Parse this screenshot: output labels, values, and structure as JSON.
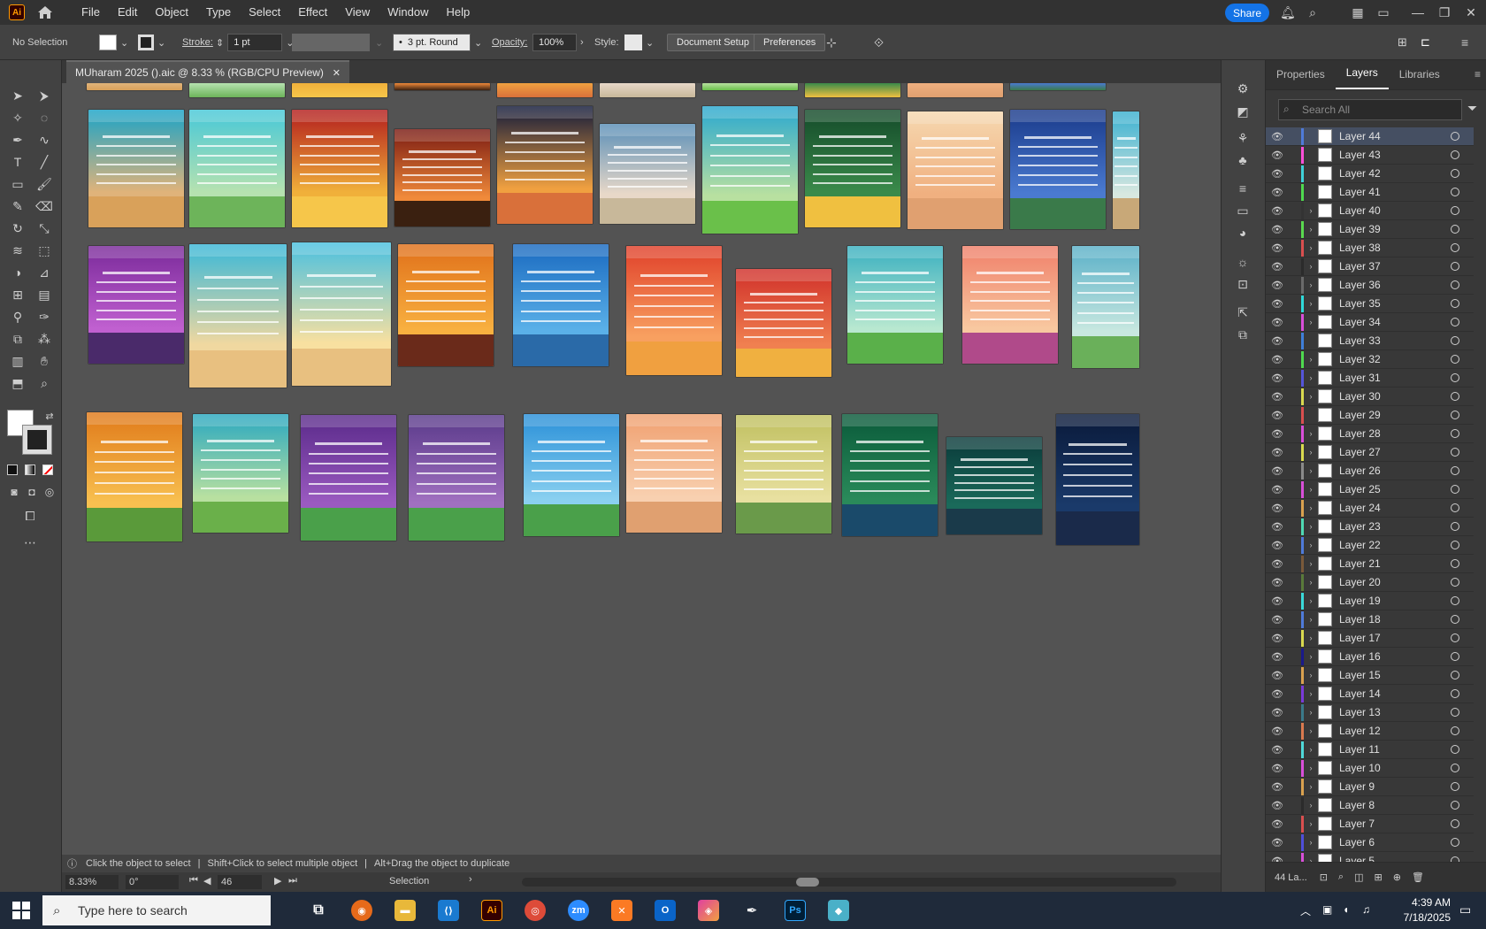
{
  "app": {
    "logo": "Ai"
  },
  "menu": [
    "File",
    "Edit",
    "Object",
    "Type",
    "Select",
    "Effect",
    "View",
    "Window",
    "Help"
  ],
  "share_label": "Share",
  "control": {
    "selection": "No Selection",
    "stroke_label": "Stroke:",
    "stroke_value": "1 pt",
    "brush": "3 pt. Round",
    "opacity_label": "Opacity:",
    "opacity_value": "100%",
    "style_label": "Style:",
    "doc_setup": "Document Setup",
    "preferences": "Preferences"
  },
  "document_tab": "MUharam 2025 ().aic @ 8.33 % (RGB/CPU Preview)",
  "status": {
    "hint_click": "Click the object to select",
    "hint_shift": "Shift+Click to select multiple object",
    "hint_alt": "Alt+Drag the object to duplicate",
    "zoom": "8.33%",
    "rotate": "0°",
    "artboard": "46",
    "tool": "Selection"
  },
  "panel": {
    "tabs": [
      "Properties",
      "Layers",
      "Libraries"
    ],
    "search_placeholder": "Search All",
    "footer_count": "44 La...",
    "layers": [
      {
        "name": "Layer 44",
        "color": "#4f7bd9",
        "expand": false,
        "selected": true
      },
      {
        "name": "Layer 43",
        "color": "#ff4fd8",
        "expand": false
      },
      {
        "name": "Layer 42",
        "color": "#3fd1d9",
        "expand": false
      },
      {
        "name": "Layer 41",
        "color": "#4fd94f",
        "expand": false
      },
      {
        "name": "Layer 40",
        "color": "#333333",
        "expand": true
      },
      {
        "name": "Layer 39",
        "color": "#5ad94f",
        "expand": true
      },
      {
        "name": "Layer 38",
        "color": "#d94f4f",
        "expand": true
      },
      {
        "name": "Layer 37",
        "color": "#2b2b2b",
        "expand": true
      },
      {
        "name": "Layer 36",
        "color": "#6a6a6a",
        "expand": true
      },
      {
        "name": "Layer 35",
        "color": "#2fd9d9",
        "expand": true
      },
      {
        "name": "Layer 34",
        "color": "#d94fd9",
        "expand": true
      },
      {
        "name": "Layer 33",
        "color": "#3f7fd9",
        "expand": false
      },
      {
        "name": "Layer 32",
        "color": "#4fd94f",
        "expand": true
      },
      {
        "name": "Layer 31",
        "color": "#5555d9",
        "expand": true
      },
      {
        "name": "Layer 30",
        "color": "#d9d94f",
        "expand": true
      },
      {
        "name": "Layer 29",
        "color": "#d94f4f",
        "expand": false
      },
      {
        "name": "Layer 28",
        "color": "#d94fd9",
        "expand": true
      },
      {
        "name": "Layer 27",
        "color": "#d9d94f",
        "expand": true
      },
      {
        "name": "Layer 26",
        "color": "#8a8a8a",
        "expand": true
      },
      {
        "name": "Layer 25",
        "color": "#d94fd9",
        "expand": true
      },
      {
        "name": "Layer 24",
        "color": "#d9a14f",
        "expand": true
      },
      {
        "name": "Layer 23",
        "color": "#4fd9b3",
        "expand": true
      },
      {
        "name": "Layer 22",
        "color": "#4f7bd9",
        "expand": true
      },
      {
        "name": "Layer 21",
        "color": "#7a5a3a",
        "expand": true
      },
      {
        "name": "Layer 20",
        "color": "#5a7a3a",
        "expand": true
      },
      {
        "name": "Layer 19",
        "color": "#3ad9d9",
        "expand": true
      },
      {
        "name": "Layer 18",
        "color": "#4f7bd9",
        "expand": true
      },
      {
        "name": "Layer 17",
        "color": "#d9d94f",
        "expand": true
      },
      {
        "name": "Layer 16",
        "color": "#1a1a8a",
        "expand": true
      },
      {
        "name": "Layer 15",
        "color": "#d9a14f",
        "expand": true
      },
      {
        "name": "Layer 14",
        "color": "#7a3ad9",
        "expand": true
      },
      {
        "name": "Layer 13",
        "color": "#3a7a8a",
        "expand": true
      },
      {
        "name": "Layer 12",
        "color": "#d97a4f",
        "expand": true
      },
      {
        "name": "Layer 11",
        "color": "#4fd9d9",
        "expand": true
      },
      {
        "name": "Layer 10",
        "color": "#d94fd9",
        "expand": true
      },
      {
        "name": "Layer 9",
        "color": "#d9a14f",
        "expand": true
      },
      {
        "name": "Layer 8",
        "color": "#2b2b2b",
        "expand": true
      },
      {
        "name": "Layer 7",
        "color": "#d94f4f",
        "expand": true
      },
      {
        "name": "Layer 6",
        "color": "#4f4fd9",
        "expand": true
      },
      {
        "name": "Layer 5",
        "color": "#d94fd9",
        "expand": true
      }
    ]
  },
  "taskbar": {
    "search_placeholder": "Type here to search",
    "time": "4:39 AM",
    "date": "7/18/2025",
    "apps": [
      "task-view",
      "firefox",
      "file-explorer",
      "vscode",
      "illustrator",
      "chrome",
      "zoom",
      "xampp",
      "outlook",
      "photos",
      "pen-tool",
      "photoshop",
      "app"
    ]
  },
  "artboards": [
    {
      "c1": "#1aa3c7",
      "c2": "#e0b37a",
      "g": "#d9a15a"
    },
    {
      "c1": "#47c8d8",
      "c2": "#b6e2b0",
      "g": "#6db45a"
    },
    {
      "c1": "#b31d1d",
      "c2": "#f0b03a",
      "g": "#f6c64a"
    },
    {
      "c1": "#7a1a12",
      "c2": "#f08a3a",
      "g": "#3a2010"
    },
    {
      "c1": "#121a3a",
      "c2": "#f0a040",
      "g": "#d9703a"
    },
    {
      "c1": "#5a8fb8",
      "c2": "#e8d8c8",
      "g": "#c8b89a"
    },
    {
      "c1": "#2aa8d0",
      "c2": "#b8e0a0",
      "g": "#6ac04a"
    },
    {
      "c1": "#144a2a",
      "c2": "#3a8a4a",
      "g": "#f0c040"
    },
    {
      "c1": "#f6d8b0",
      "c2": "#f0b080",
      "g": "#e0a070"
    },
    {
      "c1": "#1a3a8a",
      "c2": "#4a7ad0",
      "g": "#3a7a4a"
    },
    {
      "c1": "#3ab0d0",
      "c2": "#d8e8e0",
      "g": "#c8a878"
    },
    {
      "c1": "#7a2a9a",
      "c2": "#c060d0",
      "g": "#4a2a6a"
    },
    {
      "c1": "#3ab8d8",
      "c2": "#f0d8a0",
      "g": "#e8c080"
    },
    {
      "c1": "#4ac0e0",
      "c2": "#f8e0a0",
      "g": "#e8c080"
    },
    {
      "c1": "#e0701a",
      "c2": "#f8b040",
      "g": "#6a2a1a"
    },
    {
      "c1": "#1a6ac0",
      "c2": "#5ab0e8",
      "g": "#2a6aa8"
    },
    {
      "c1": "#e0402a",
      "c2": "#f8a060",
      "g": "#f0a040"
    },
    {
      "c1": "#d0302a",
      "c2": "#f08050",
      "g": "#f0b040"
    },
    {
      "c1": "#3ab0c0",
      "c2": "#b8e8d0",
      "g": "#5ab04a"
    },
    {
      "c1": "#f0806a",
      "c2": "#f8c8a0",
      "g": "#b04a8a"
    },
    {
      "c1": "#5ab0c8",
      "c2": "#c8e8e0",
      "g": "#6ab05a"
    },
    {
      "c1": "#e07a1a",
      "c2": "#f8c050",
      "g": "#5a9a3a"
    },
    {
      "c1": "#2aa8c0",
      "c2": "#b8e0a0",
      "g": "#6ab04a"
    },
    {
      "c1": "#5a2a8a",
      "c2": "#9a5ac0",
      "g": "#4aa04a"
    },
    {
      "c1": "#5a3a8a",
      "c2": "#a070c0",
      "g": "#4aa04a"
    },
    {
      "c1": "#2a90d8",
      "c2": "#8ad0f0",
      "g": "#4aa04a"
    },
    {
      "c1": "#f0a070",
      "c2": "#f8d0b0",
      "g": "#e0a070"
    },
    {
      "c1": "#c0c060",
      "c2": "#e8e0a0",
      "g": "#6a9a4a"
    },
    {
      "c1": "#0a5a3a",
      "c2": "#2a8a5a",
      "g": "#1a4a6a"
    },
    {
      "c1": "#0a3a3a",
      "c2": "#1a6a5a",
      "g": "#1a3a4a"
    },
    {
      "c1": "#0a1a3a",
      "c2": "#1a3a6a",
      "g": "#1a2a4a"
    }
  ]
}
